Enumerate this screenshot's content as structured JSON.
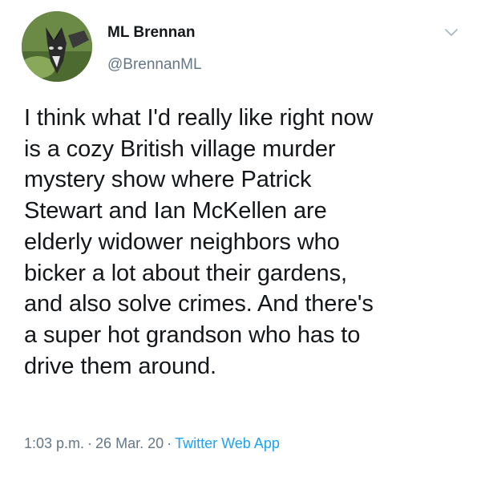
{
  "tweet": {
    "author_name": "ML Brennan",
    "author_handle": "@BrennanML",
    "text": "I think what I'd really like right now\nis a cozy British village murder\nmystery show where Patrick\nStewart and Ian McKellen are\nelderly widower neighbors who\nbicker a lot about their gardens,\nand also solve crimes. And there's\na super hot grandson who has to\ndrive them around.",
    "time": "1:03 p.m.",
    "separator": "·",
    "date": "26 Mar. 20",
    "source": "Twitter Web App"
  },
  "icons": {
    "menu": "chevron-down-icon",
    "avatar": "avatar-image"
  },
  "colors": {
    "text": "#14171a",
    "secondary": "#657786",
    "link": "#1da1f2",
    "caret": "#aab8c2"
  }
}
